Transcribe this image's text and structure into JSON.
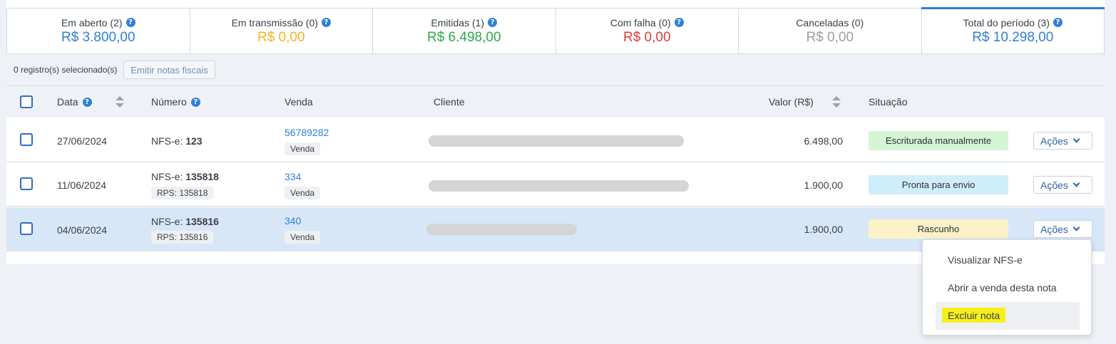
{
  "cards": [
    {
      "label": "Em aberto (2)",
      "value": "R$ 3.800,00",
      "color": "#2f7fd8",
      "help": true
    },
    {
      "label": "Em transmissão (0)",
      "value": "R$ 0,00",
      "color": "#f4b324",
      "help": true
    },
    {
      "label": "Emitidas (1)",
      "value": "R$ 6.498,00",
      "color": "#2ea84a",
      "help": true
    },
    {
      "label": "Com falha (0)",
      "value": "R$ 0,00",
      "color": "#e53935",
      "help": true
    },
    {
      "label": "Canceladas (0)",
      "value": "R$ 0,00",
      "color": "#9a9fa5",
      "help": false
    },
    {
      "label": "Total do período (3)",
      "value": "R$ 10.298,00",
      "color": "#2f7fd8",
      "help": true
    }
  ],
  "selection": {
    "count_text": "0 registro(s) selecionado(s)",
    "emit_label": "Emitir notas fiscais"
  },
  "columns": {
    "data": "Data",
    "numero": "Número",
    "venda": "Venda",
    "cliente": "Cliente",
    "valor": "Valor (R$)",
    "situacao": "Situação"
  },
  "help_glyph": "?",
  "rows": [
    {
      "date": "27/06/2024",
      "nfse_prefix": "NFS-e:",
      "nfse_number": "123",
      "rps": "",
      "venda_id": "56789282",
      "venda_tag": "Venda",
      "valor": "6.498,00",
      "status": "Escriturada manualmente",
      "status_color": "#d3f5d3",
      "acoes": "Ações"
    },
    {
      "date": "11/06/2024",
      "nfse_prefix": "NFS-e:",
      "nfse_number": "135818",
      "rps": "RPS: 135818",
      "venda_id": "334",
      "venda_tag": "Venda",
      "valor": "1.900,00",
      "status": "Pronta para envio",
      "status_color": "#cfeefb",
      "acoes": "Ações"
    },
    {
      "date": "04/06/2024",
      "nfse_prefix": "NFS-e:",
      "nfse_number": "135816",
      "rps": "RPS: 135816",
      "venda_id": "340",
      "venda_tag": "Venda",
      "valor": "1.900,00",
      "status": "Rascunho",
      "status_color": "#fdf1c7",
      "acoes": "Ações"
    }
  ],
  "menu": {
    "items": [
      "Visualizar NFS-e",
      "Abrir a venda desta nota",
      "Excluir nota"
    ]
  }
}
